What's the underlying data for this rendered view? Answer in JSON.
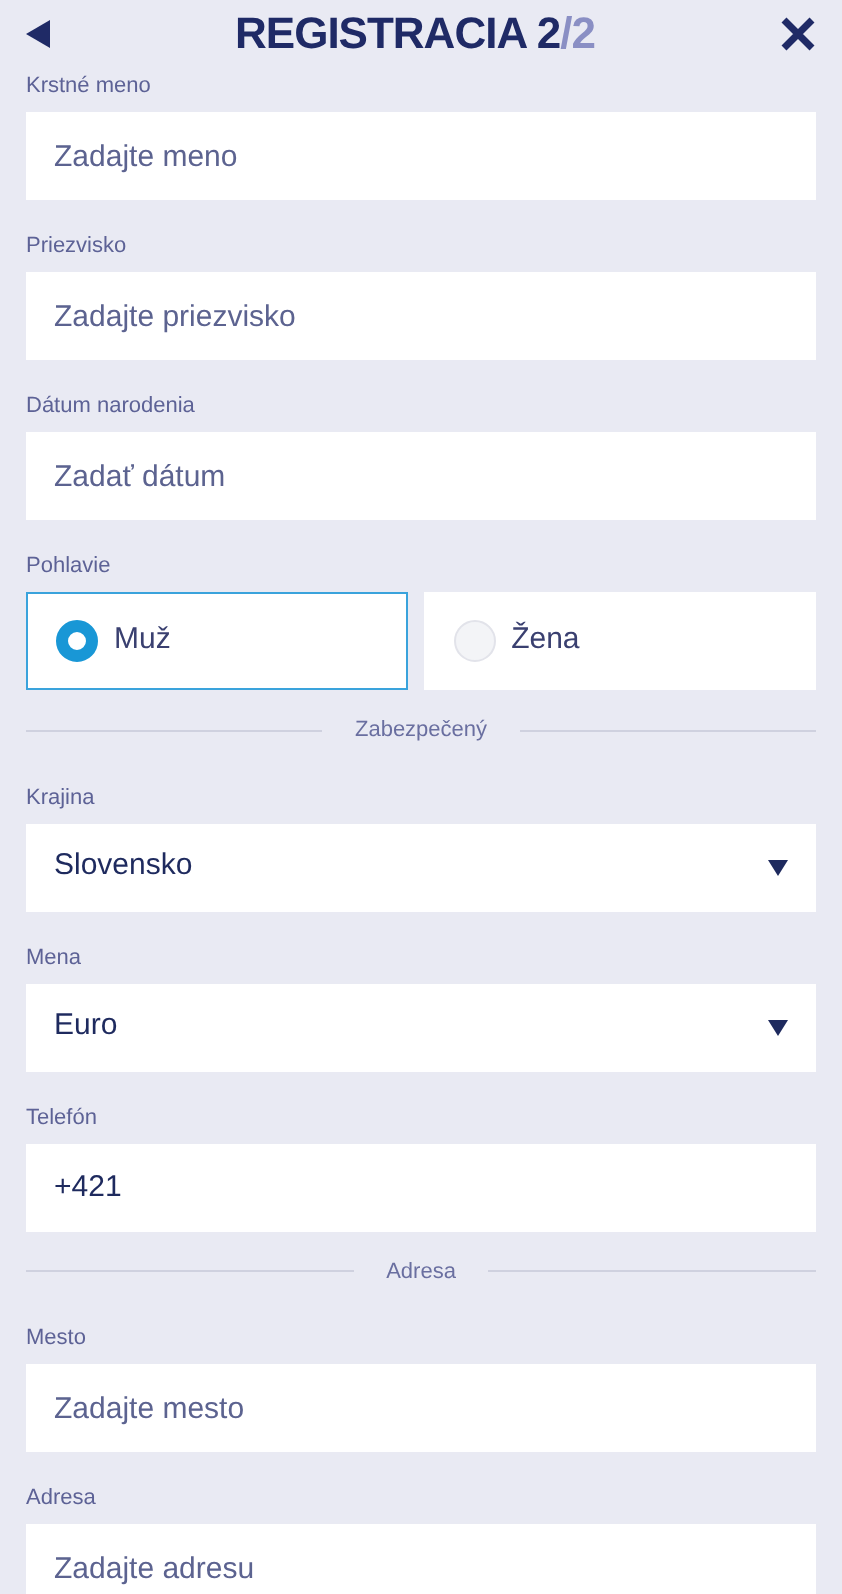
{
  "header": {
    "title": "REGISTRACIA 2",
    "title_suffix": "/2"
  },
  "form": [
    {
      "kind": "text",
      "label": "Krstné meno",
      "placeholder": "Zadajte meno"
    },
    {
      "kind": "text",
      "label": "Priezvisko",
      "placeholder": "Zadajte priezvisko"
    },
    {
      "kind": "text",
      "label": "Dátum narodenia",
      "placeholder": "Zadať dátum"
    },
    {
      "kind": "radio",
      "label": "Pohlavie",
      "options": [
        {
          "label": "Muž",
          "selected": true
        },
        {
          "label": "Žena",
          "selected": false
        }
      ]
    },
    {
      "kind": "divider",
      "label": "Zabezpečený"
    },
    {
      "kind": "select",
      "label": "Krajina",
      "value": "Slovensko"
    },
    {
      "kind": "select",
      "label": "Mena",
      "value": "Euro"
    },
    {
      "kind": "text",
      "label": "Telefón",
      "value": "+421"
    },
    {
      "kind": "divider",
      "label": "Adresa"
    },
    {
      "kind": "text",
      "label": "Mesto",
      "placeholder": "Zadajte mesto"
    },
    {
      "kind": "text",
      "label": "Adresa",
      "placeholder": "Zadajte adresu"
    }
  ]
}
